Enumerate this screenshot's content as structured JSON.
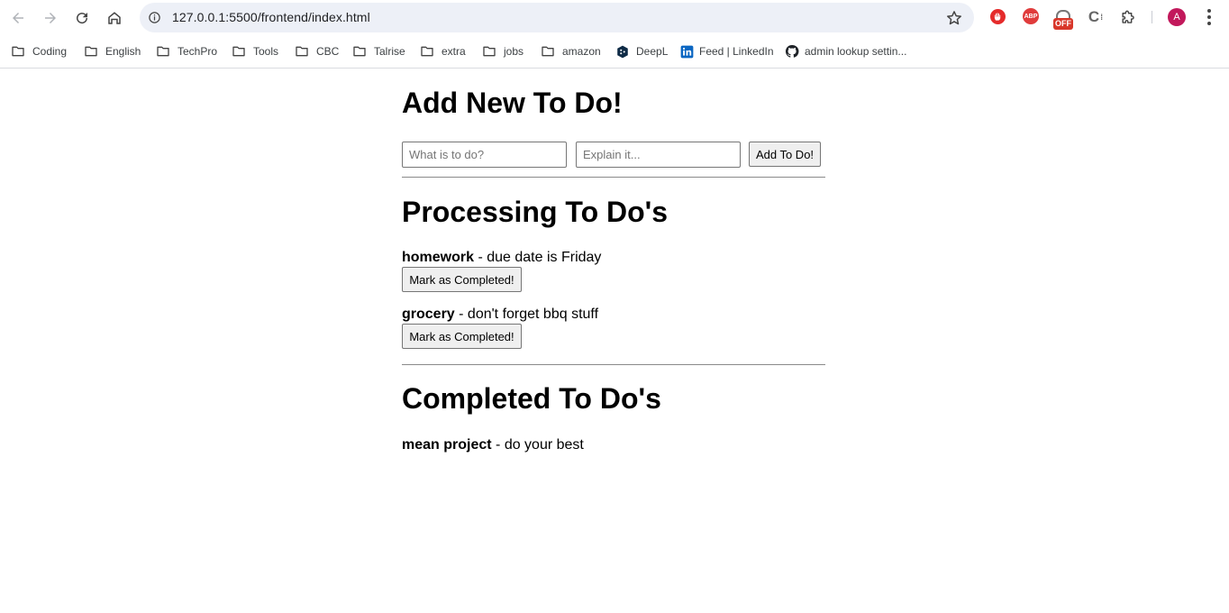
{
  "browser": {
    "url": "127.0.0.1:5500/frontend/index.html",
    "avatar_letter": "A",
    "ext_abp_label": "ABP",
    "ext_off_label": "OFF",
    "ext_c_label": "C",
    "bookmarks": [
      {
        "label": "Coding",
        "icon": "folder-icon"
      },
      {
        "label": "English",
        "icon": "folder-icon"
      },
      {
        "label": "TechPro",
        "icon": "folder-icon"
      },
      {
        "label": "Tools",
        "icon": "folder-icon"
      },
      {
        "label": "CBC",
        "icon": "folder-icon"
      },
      {
        "label": "Talrise",
        "icon": "folder-icon"
      },
      {
        "label": "extra",
        "icon": "folder-icon"
      },
      {
        "label": "jobs",
        "icon": "folder-icon"
      },
      {
        "label": "amazon",
        "icon": "folder-icon"
      },
      {
        "label": "DeepL",
        "icon": "deepl-icon"
      },
      {
        "label": "Feed | LinkedIn",
        "icon": "linkedin-icon"
      },
      {
        "label": "admin lookup settin...",
        "icon": "github-icon"
      }
    ]
  },
  "page": {
    "add_heading": "Add New To Do!",
    "title_placeholder": "What is to do?",
    "desc_placeholder": "Explain it...",
    "title_value": "",
    "desc_value": "",
    "add_button": "Add To Do!",
    "processing_heading": "Processing To Do's",
    "processing": [
      {
        "title": "homework",
        "description": " - due date is Friday",
        "button": "Mark as Completed!"
      },
      {
        "title": "grocery",
        "description": " - don't forget bbq stuff",
        "button": "Mark as Completed!"
      }
    ],
    "completed_heading": "Completed To Do's",
    "completed": [
      {
        "title": "mean project",
        "description": " - do your best"
      }
    ]
  }
}
